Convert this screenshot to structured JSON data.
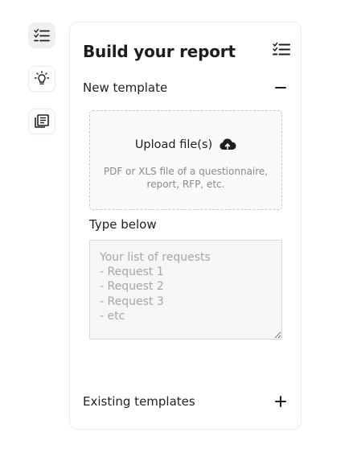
{
  "panel": {
    "title": "Build your report",
    "new_template": {
      "label": "New template",
      "toggle_symbol": "−",
      "upload": {
        "title": "Upload file(s)",
        "hint": "PDF or XLS file of a questionnaire, report, RFP, etc."
      },
      "type_below_label": "Type below",
      "textarea_placeholder": "Your list of requests\n- Request 1\n- Request 2\n- Request 3\n- etc"
    },
    "existing_templates": {
      "label": "Existing templates",
      "toggle_symbol": "+"
    }
  },
  "rail": {
    "items": [
      {
        "icon": "checklist-icon",
        "active": true
      },
      {
        "icon": "lightbulb-icon",
        "active": false
      },
      {
        "icon": "library-icon",
        "active": false
      }
    ]
  },
  "icons": {
    "panel_menu": "checklist-icon",
    "upload": "cloud-upload-icon"
  }
}
